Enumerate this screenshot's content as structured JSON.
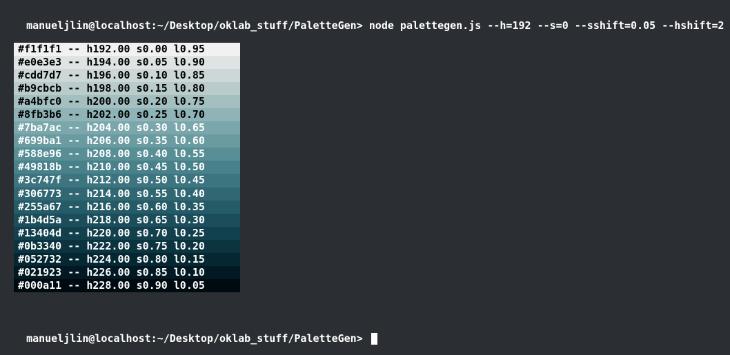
{
  "prompt1": "manueljlin@localhost:~/Desktop/oklab_stuff/PaletteGen> node palettegen.js --h=192 --s=0 --sshift=0.05 --hshift=2",
  "prompt2": "manueljlin@localhost:~/Desktop/oklab_stuff/PaletteGen> ",
  "rows": [
    {
      "hex": "#f1f1f1",
      "bg": "#f1f1f1",
      "fg": "#000000",
      "h": "h192.00",
      "s": "s0.00",
      "l": "l0.95"
    },
    {
      "hex": "#e0e3e3",
      "bg": "#e0e3e3",
      "fg": "#000000",
      "h": "h194.00",
      "s": "s0.05",
      "l": "l0.90"
    },
    {
      "hex": "#cdd7d7",
      "bg": "#cdd7d7",
      "fg": "#000000",
      "h": "h196.00",
      "s": "s0.10",
      "l": "l0.85"
    },
    {
      "hex": "#b9cbcb",
      "bg": "#b9cbcb",
      "fg": "#000000",
      "h": "h198.00",
      "s": "s0.15",
      "l": "l0.80"
    },
    {
      "hex": "#a4bfc0",
      "bg": "#a4bfc0",
      "fg": "#000000",
      "h": "h200.00",
      "s": "s0.20",
      "l": "l0.75"
    },
    {
      "hex": "#8fb3b6",
      "bg": "#8fb3b6",
      "fg": "#000000",
      "h": "h202.00",
      "s": "s0.25",
      "l": "l0.70"
    },
    {
      "hex": "#7ba7ac",
      "bg": "#7ba7ac",
      "fg": "#ffffff",
      "h": "h204.00",
      "s": "s0.30",
      "l": "l0.65"
    },
    {
      "hex": "#699ba1",
      "bg": "#699ba1",
      "fg": "#ffffff",
      "h": "h206.00",
      "s": "s0.35",
      "l": "l0.60"
    },
    {
      "hex": "#588e96",
      "bg": "#588e96",
      "fg": "#ffffff",
      "h": "h208.00",
      "s": "s0.40",
      "l": "l0.55"
    },
    {
      "hex": "#49818b",
      "bg": "#49818b",
      "fg": "#ffffff",
      "h": "h210.00",
      "s": "s0.45",
      "l": "l0.50"
    },
    {
      "hex": "#3c747f",
      "bg": "#3c747f",
      "fg": "#ffffff",
      "h": "h212.00",
      "s": "s0.50",
      "l": "l0.45"
    },
    {
      "hex": "#306773",
      "bg": "#306773",
      "fg": "#ffffff",
      "h": "h214.00",
      "s": "s0.55",
      "l": "l0.40"
    },
    {
      "hex": "#255a67",
      "bg": "#255a67",
      "fg": "#ffffff",
      "h": "h216.00",
      "s": "s0.60",
      "l": "l0.35"
    },
    {
      "hex": "#1b4d5a",
      "bg": "#1b4d5a",
      "fg": "#ffffff",
      "h": "h218.00",
      "s": "s0.65",
      "l": "l0.30"
    },
    {
      "hex": "#13404d",
      "bg": "#13404d",
      "fg": "#ffffff",
      "h": "h220.00",
      "s": "s0.70",
      "l": "l0.25"
    },
    {
      "hex": "#0b3340",
      "bg": "#0b3340",
      "fg": "#ffffff",
      "h": "h222.00",
      "s": "s0.75",
      "l": "l0.20"
    },
    {
      "hex": "#052732",
      "bg": "#052732",
      "fg": "#ffffff",
      "h": "h224.00",
      "s": "s0.80",
      "l": "l0.15"
    },
    {
      "hex": "#021923",
      "bg": "#021923",
      "fg": "#ffffff",
      "h": "h226.00",
      "s": "s0.85",
      "l": "l0.10"
    },
    {
      "hex": "#000a11",
      "bg": "#000a11",
      "fg": "#ffffff",
      "h": "h228.00",
      "s": "s0.90",
      "l": "l0.05"
    }
  ]
}
